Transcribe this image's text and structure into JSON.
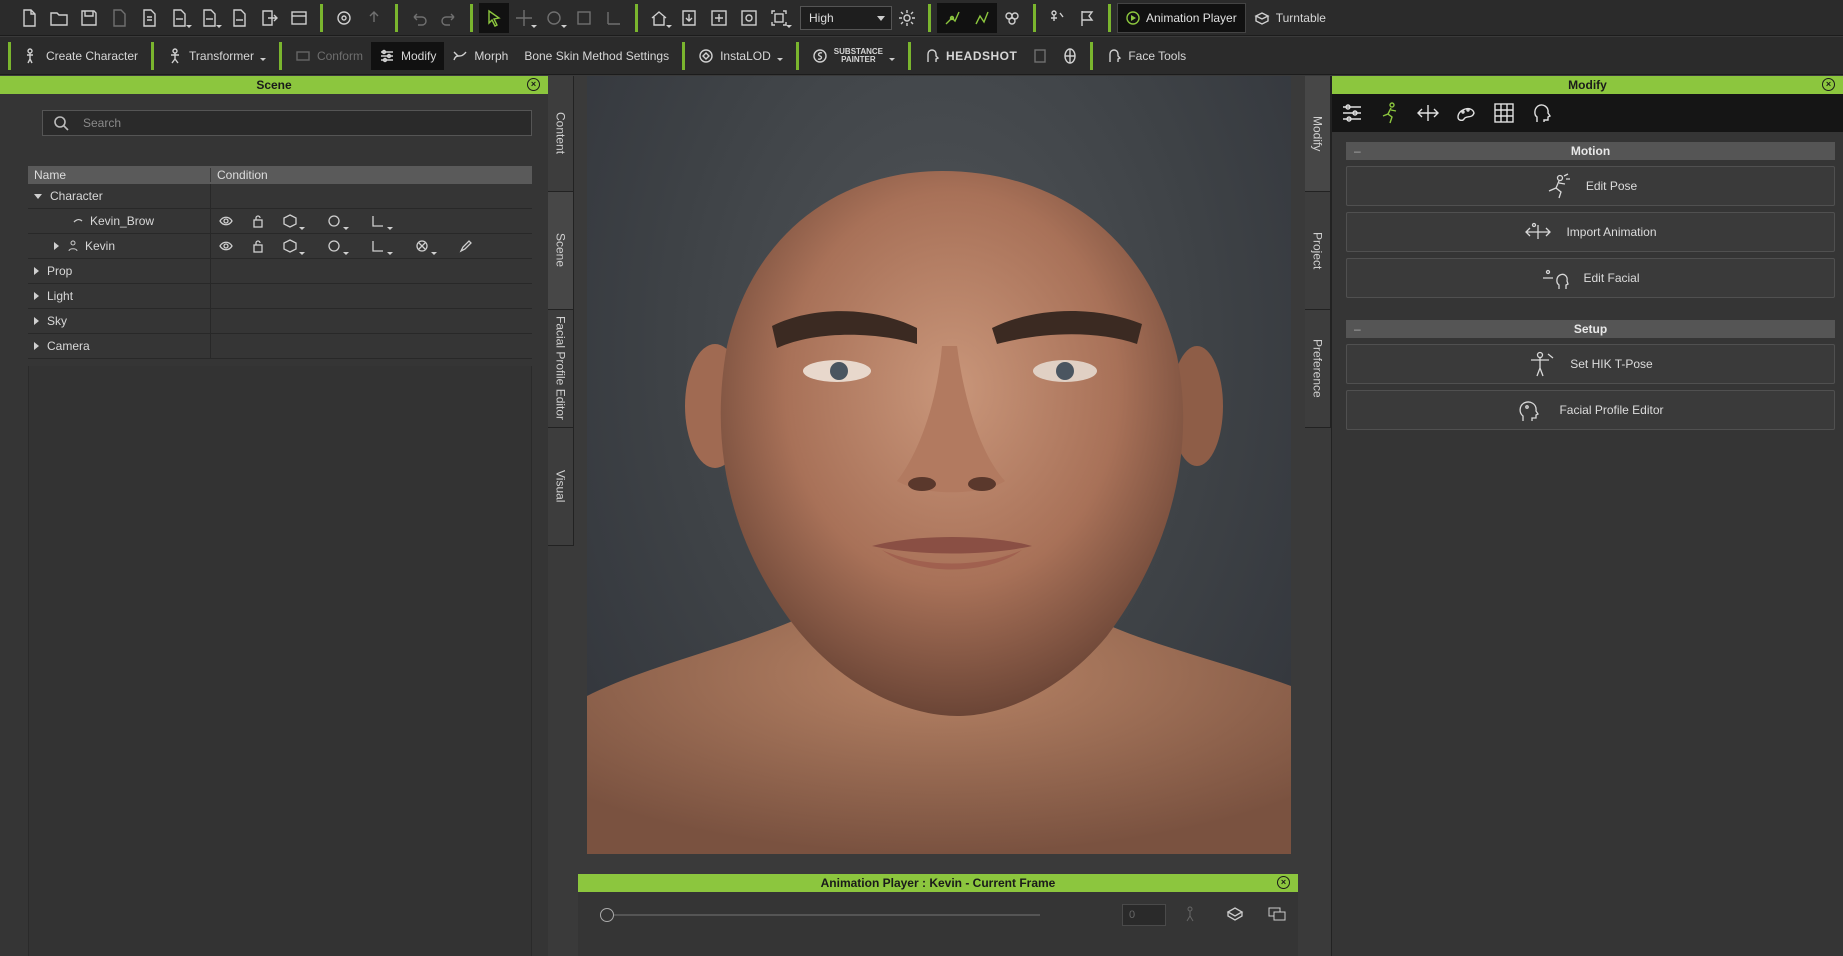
{
  "toolbar1": {
    "quality_value": "High",
    "animation_player_label": "Animation Player",
    "turntable_label": "Turntable"
  },
  "toolbar2": {
    "create_character": "Create Character",
    "transformer": "Transformer",
    "conform": "Conform",
    "modify": "Modify",
    "morph": "Morph",
    "bone_skin": "Bone Skin Method Settings",
    "instalod": "InstaLOD",
    "substance_line1": "SUBSTANCE",
    "substance_line2": "PAINTER",
    "headshot": "HEADSHOT",
    "face_tools": "Face Tools"
  },
  "scene": {
    "title": "Scene",
    "search_placeholder": "Search",
    "col_name": "Name",
    "col_condition": "Condition",
    "rows": [
      {
        "label": "Character"
      },
      {
        "label": "Kevin_Brow"
      },
      {
        "label": "Kevin"
      },
      {
        "label": "Prop"
      },
      {
        "label": "Light"
      },
      {
        "label": "Sky"
      },
      {
        "label": "Camera"
      }
    ]
  },
  "left_tabs": [
    "Content",
    "Scene",
    "Facial Profile Editor",
    "Visual"
  ],
  "right_tabs": [
    "Modify",
    "Project",
    "Preference"
  ],
  "anim_player": {
    "title": "Animation Player : Kevin - Current Frame",
    "frame_value": "0"
  },
  "modify": {
    "title": "Modify",
    "motion_section": "Motion",
    "setup_section": "Setup",
    "buttons": {
      "edit_pose": "Edit Pose",
      "import_animation": "Import Animation",
      "edit_facial": "Edit Facial",
      "set_hik": "Set HIK T-Pose",
      "facial_profile": "Facial Profile Editor"
    }
  },
  "colors": {
    "accent": "#8cc63e",
    "panel": "#353535",
    "toolbar": "#2b2b2b"
  }
}
